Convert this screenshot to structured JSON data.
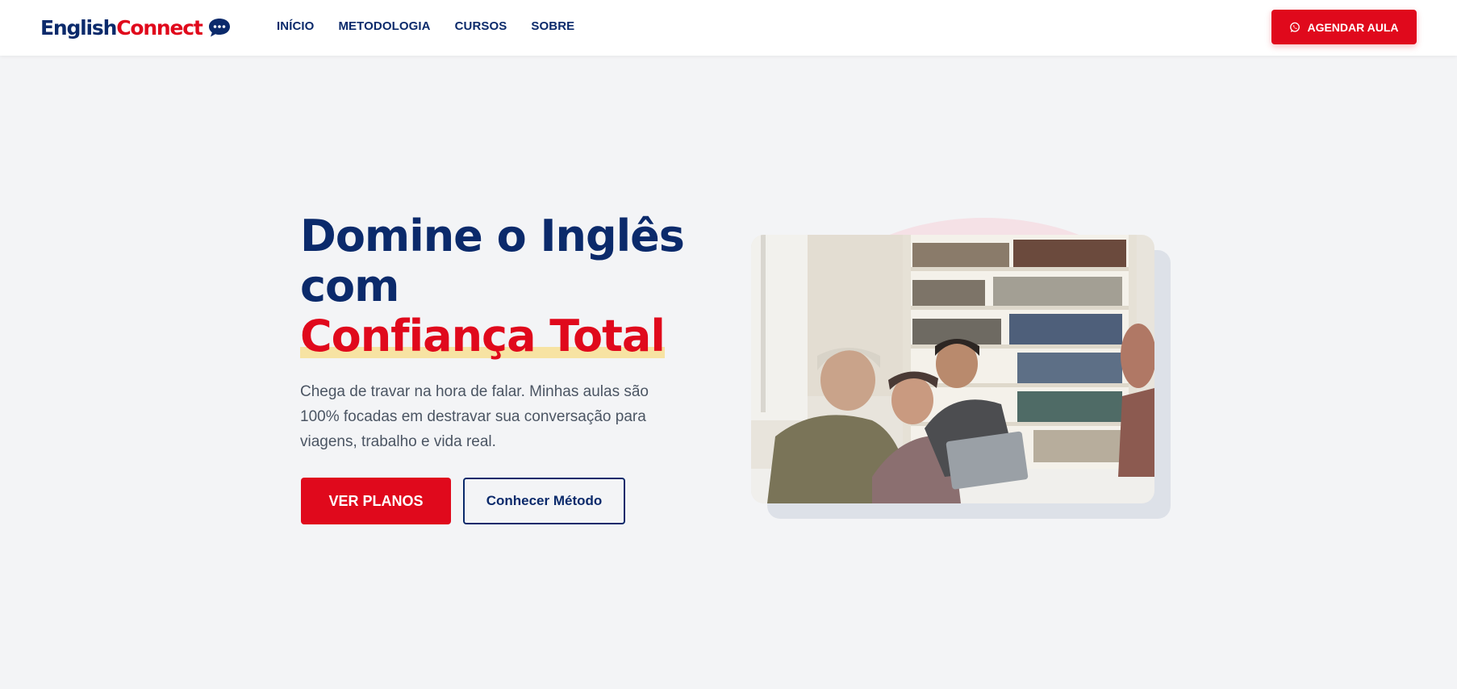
{
  "brand": {
    "logo_part1": "English",
    "logo_part2": "Connect",
    "chat_icon": "chat-bubble-icon",
    "primary_color": "#0b2a6b",
    "accent_color": "#e0091c"
  },
  "nav": {
    "items": [
      {
        "label": "INÍCIO"
      },
      {
        "label": "METODOLOGIA"
      },
      {
        "label": "CURSOS"
      },
      {
        "label": "SOBRE"
      }
    ],
    "cta_label": "AGENDAR AULA",
    "cta_icon": "whatsapp-icon"
  },
  "hero": {
    "title_line1": "Domine o Inglês",
    "title_line2": "com",
    "title_highlight": "Confiança Total",
    "description": "Chega de travar na hora de falar. Minhas aulas são 100% focadas em destravar sua conversação para viagens, trabalho e vida real.",
    "primary_button": "VER PLANOS",
    "secondary_button": "Conhecer Método"
  }
}
